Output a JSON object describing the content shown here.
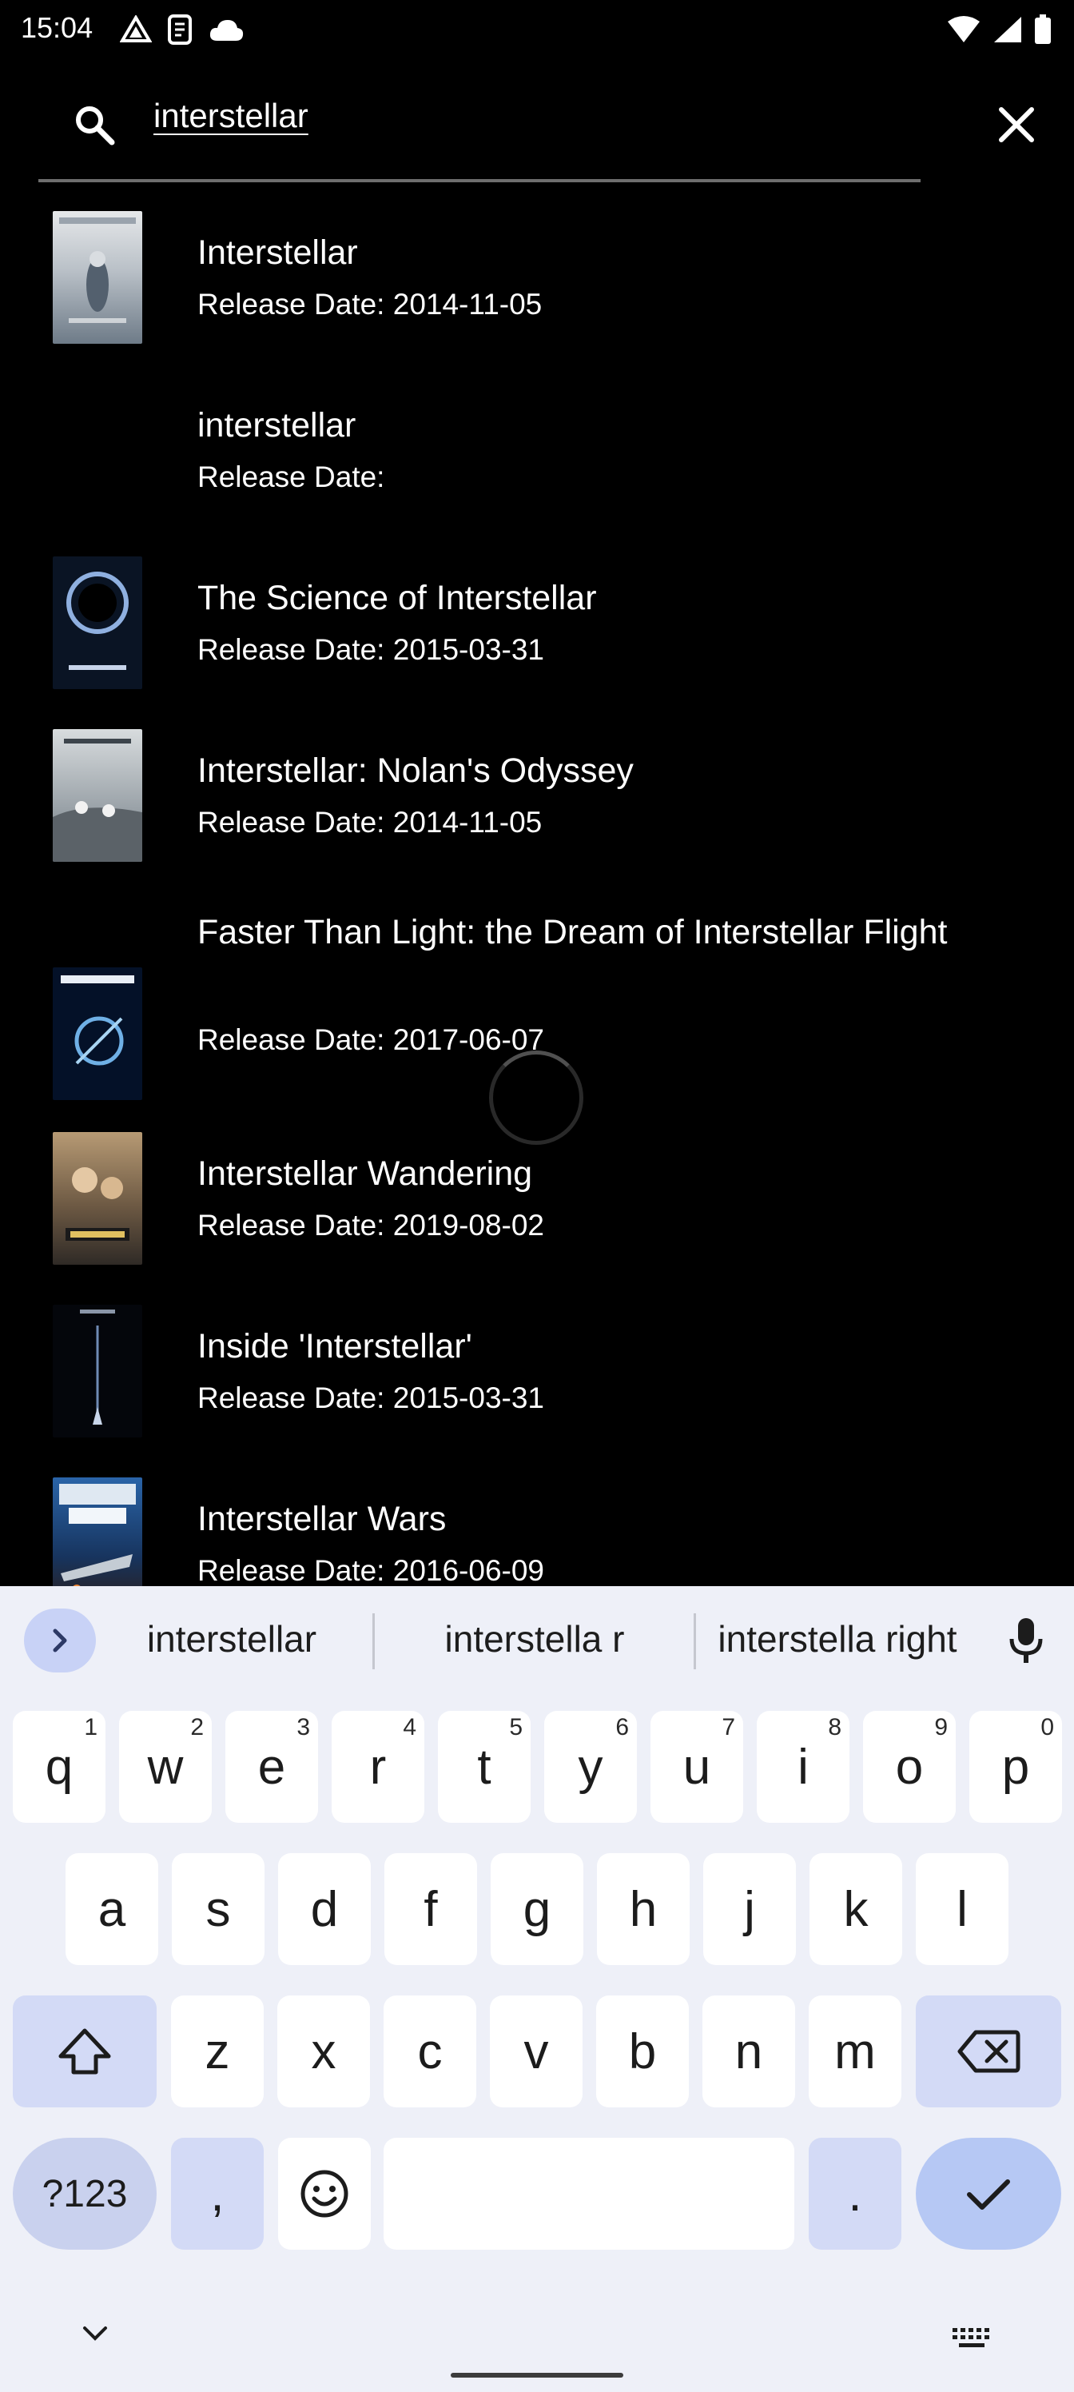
{
  "status_bar": {
    "time": "15:04",
    "icons_left": [
      "drive-icon",
      "screenshot-icon",
      "cloud-icon"
    ],
    "icons_right": [
      "wifi-icon",
      "signal-icon",
      "battery-icon"
    ]
  },
  "search": {
    "query": "interstellar",
    "icon": "search-icon",
    "clear_icon": "close-icon"
  },
  "results": [
    {
      "title": "Interstellar",
      "date": "Release Date: 2014-11-05",
      "poster": true,
      "poster_colors": [
        "#c9ccd0",
        "#7d8a96"
      ]
    },
    {
      "title": "interstellar",
      "date": "Release Date:",
      "poster": false
    },
    {
      "title": "The Science of Interstellar",
      "date": "Release Date: 2015-03-31",
      "poster": true,
      "poster_colors": [
        "#0b1220",
        "#3a5a8a"
      ]
    },
    {
      "title": "Interstellar: Nolan's Odyssey",
      "date": "Release Date: 2014-11-05",
      "poster": true,
      "poster_colors": [
        "#8a9096",
        "#c8ccd0"
      ]
    },
    {
      "title": "Faster Than Light: the Dream of Interstellar Flight",
      "date": "Release Date: 2017-06-07",
      "poster": true,
      "poster_colors": [
        "#061126",
        "#3a78b0"
      ]
    },
    {
      "title": "Interstellar Wandering",
      "date": "Release Date: 2019-08-02",
      "poster": true,
      "poster_colors": [
        "#5a4632",
        "#b8a07a"
      ]
    },
    {
      "title": "Inside 'Interstellar'",
      "date": "Release Date: 2015-03-31",
      "poster": true,
      "poster_colors": [
        "#05070c",
        "#6a86b0"
      ]
    },
    {
      "title": "Interstellar Wars",
      "date": "Release Date: 2016-06-09",
      "poster": true,
      "poster_colors": [
        "#1a4a86",
        "#c0d0e4"
      ]
    }
  ],
  "keyboard": {
    "suggestions": [
      "interstellar",
      "interstella r",
      "interstella right"
    ],
    "row1": [
      {
        "k": "q",
        "h": "1"
      },
      {
        "k": "w",
        "h": "2"
      },
      {
        "k": "e",
        "h": "3"
      },
      {
        "k": "r",
        "h": "4"
      },
      {
        "k": "t",
        "h": "5"
      },
      {
        "k": "y",
        "h": "6"
      },
      {
        "k": "u",
        "h": "7"
      },
      {
        "k": "i",
        "h": "8"
      },
      {
        "k": "o",
        "h": "9"
      },
      {
        "k": "p",
        "h": "0"
      }
    ],
    "row2": [
      "a",
      "s",
      "d",
      "f",
      "g",
      "h",
      "j",
      "k",
      "l"
    ],
    "row3": [
      "z",
      "x",
      "c",
      "v",
      "b",
      "n",
      "m"
    ],
    "symbols_label": "?123",
    "comma_label": ",",
    "period_label": ".",
    "accent_color": "#b6c8f4"
  }
}
